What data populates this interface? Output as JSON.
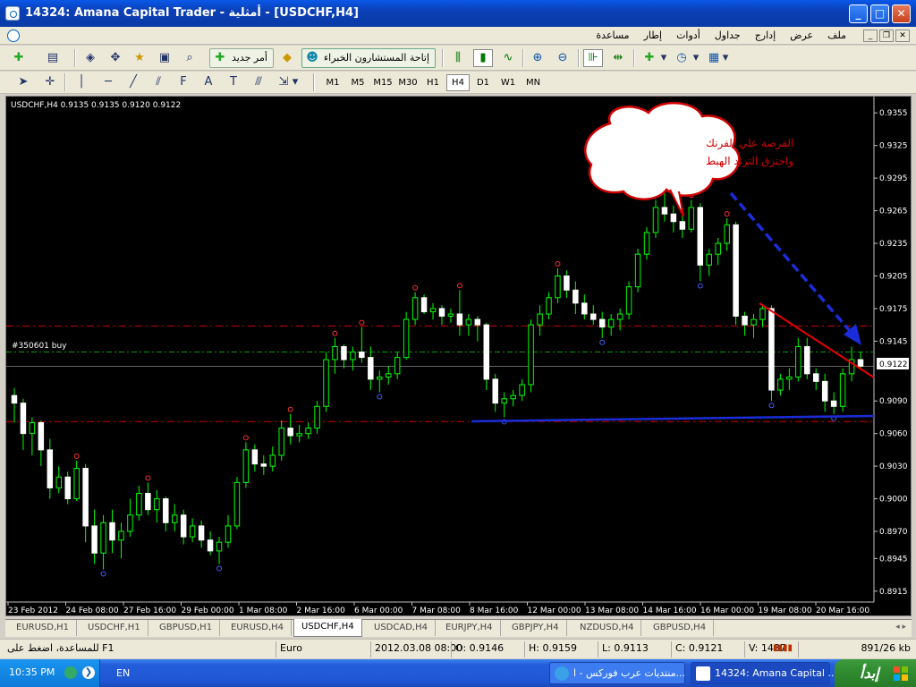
{
  "window": {
    "title": "14324: Amana Capital Trader - أمثلية - [USDCHF,H4]",
    "min": "_",
    "max": "□",
    "close": "✕"
  },
  "menu": [
    "ملف",
    "عرض",
    "إدارج",
    "جداول",
    "أدوات",
    "إطار",
    "مساعدة"
  ],
  "toolbar1": {
    "new_order": "أمر جديد",
    "experts": "إتاحة المستشارون الخبراء"
  },
  "timeframes": [
    "M1",
    "M5",
    "M15",
    "M30",
    "H1",
    "H4",
    "D1",
    "W1",
    "MN"
  ],
  "active_timeframe": "H4",
  "chart": {
    "header": "USDCHF,H4  0.9135 0.9135 0.9120 0.9122",
    "order_label": "#350601 buy",
    "current_price": "0.9122",
    "price_labels": [
      "0.9355",
      "0.9325",
      "0.9295",
      "0.9265",
      "0.9235",
      "0.9205",
      "0.9175",
      "0.9145",
      "0.9122",
      "0.9090",
      "0.9060",
      "0.9030",
      "0.9000",
      "0.8970",
      "0.8945",
      "0.8915"
    ],
    "time_labels": [
      "23 Feb 2012",
      "24 Feb 08:00",
      "27 Feb 16:00",
      "29 Feb 00:00",
      "1 Mar 08:00",
      "2 Mar 16:00",
      "6 Mar 00:00",
      "7 Mar 08:00",
      "8 Mar 16:00",
      "12 Mar 00:00",
      "13 Mar 08:00",
      "14 Mar 16:00",
      "16 Mar 00:00",
      "19 Mar 08:00",
      "20 Mar 16:00"
    ],
    "bubble_line1": "الفرصة علي الفرنك",
    "bubble_line2": "واختزق الترند الهبط",
    "bull_color": "#00ff00",
    "background": "#000000"
  },
  "chart_data": {
    "type": "candlestick",
    "symbol": "USDCHF",
    "timeframe": "H4",
    "ylim": [
      0.8905,
      0.937
    ],
    "price_levels": {
      "resistance_red_dash": 0.9159,
      "order_green": 0.9135,
      "current": 0.9122,
      "support_red_dash": 0.9071
    },
    "series": [
      {
        "values": [
          [
            0.9095,
            0.9102,
            0.907,
            0.9088
          ],
          [
            0.9088,
            0.9092,
            0.9045,
            0.906
          ],
          [
            0.906,
            0.9075,
            0.904,
            0.907
          ],
          [
            0.907,
            0.9072,
            0.903,
            0.9045
          ],
          [
            0.9045,
            0.9055,
            0.9,
            0.901
          ],
          [
            0.901,
            0.903,
            0.9005,
            0.902
          ],
          [
            0.902,
            0.9025,
            0.8995,
            0.9
          ],
          [
            0.9,
            0.9035,
            0.8998,
            0.9028
          ],
          [
            0.9028,
            0.9032,
            0.896,
            0.8975
          ],
          [
            0.8975,
            0.899,
            0.894,
            0.895
          ],
          [
            0.895,
            0.8985,
            0.8935,
            0.8978
          ],
          [
            0.8978,
            0.899,
            0.895,
            0.8962
          ],
          [
            0.8962,
            0.8978,
            0.8945,
            0.897
          ],
          [
            0.897,
            0.9,
            0.8965,
            0.8985
          ],
          [
            0.8985,
            0.9012,
            0.898,
            0.9005
          ],
          [
            0.9005,
            0.9015,
            0.8985,
            0.899
          ],
          [
            0.899,
            0.9008,
            0.8978,
            0.9
          ],
          [
            0.9,
            0.9002,
            0.897,
            0.8978
          ],
          [
            0.8978,
            0.8995,
            0.897,
            0.8985
          ],
          [
            0.8985,
            0.899,
            0.8958,
            0.8965
          ],
          [
            0.8965,
            0.8982,
            0.896,
            0.8975
          ],
          [
            0.8975,
            0.898,
            0.8955,
            0.8962
          ],
          [
            0.8962,
            0.897,
            0.8948,
            0.8952
          ],
          [
            0.8952,
            0.8965,
            0.894,
            0.896
          ],
          [
            0.896,
            0.8985,
            0.8955,
            0.8975
          ],
          [
            0.8975,
            0.902,
            0.8972,
            0.9015
          ],
          [
            0.9015,
            0.9052,
            0.901,
            0.9045
          ],
          [
            0.9045,
            0.905,
            0.9025,
            0.9032
          ],
          [
            0.9032,
            0.904,
            0.9022,
            0.903
          ],
          [
            0.903,
            0.9048,
            0.9025,
            0.904
          ],
          [
            0.904,
            0.9072,
            0.9035,
            0.9065
          ],
          [
            0.9065,
            0.9078,
            0.905,
            0.9058
          ],
          [
            0.9058,
            0.9068,
            0.9052,
            0.906
          ],
          [
            0.906,
            0.907,
            0.9055,
            0.9065
          ],
          [
            0.9065,
            0.909,
            0.906,
            0.9085
          ],
          [
            0.9085,
            0.9135,
            0.908,
            0.9128
          ],
          [
            0.9128,
            0.9148,
            0.9115,
            0.914
          ],
          [
            0.914,
            0.9142,
            0.912,
            0.9128
          ],
          [
            0.9128,
            0.914,
            0.9118,
            0.9135
          ],
          [
            0.9135,
            0.9158,
            0.9125,
            0.913
          ],
          [
            0.913,
            0.914,
            0.91,
            0.911
          ],
          [
            0.911,
            0.9118,
            0.9098,
            0.9112
          ],
          [
            0.9112,
            0.9122,
            0.9105,
            0.9115
          ],
          [
            0.9115,
            0.9135,
            0.911,
            0.913
          ],
          [
            0.913,
            0.9172,
            0.9128,
            0.9165
          ],
          [
            0.9165,
            0.919,
            0.916,
            0.9185
          ],
          [
            0.9185,
            0.9188,
            0.917,
            0.9172
          ],
          [
            0.9172,
            0.918,
            0.9165,
            0.9175
          ],
          [
            0.9175,
            0.9178,
            0.916,
            0.9168
          ],
          [
            0.9168,
            0.9175,
            0.9162,
            0.917
          ],
          [
            0.917,
            0.9192,
            0.915,
            0.916
          ],
          [
            0.916,
            0.917,
            0.915,
            0.9165
          ],
          [
            0.9165,
            0.9168,
            0.9145,
            0.916
          ],
          [
            0.916,
            0.9162,
            0.91,
            0.911
          ],
          [
            0.911,
            0.9115,
            0.908,
            0.9088
          ],
          [
            0.9088,
            0.9098,
            0.9075,
            0.9092
          ],
          [
            0.9092,
            0.91,
            0.9085,
            0.9095
          ],
          [
            0.9095,
            0.911,
            0.909,
            0.9105
          ],
          [
            0.9105,
            0.9165,
            0.9098,
            0.916
          ],
          [
            0.916,
            0.9178,
            0.915,
            0.917
          ],
          [
            0.917,
            0.919,
            0.9165,
            0.9185
          ],
          [
            0.9185,
            0.9212,
            0.918,
            0.9205
          ],
          [
            0.9205,
            0.921,
            0.9185,
            0.9192
          ],
          [
            0.9192,
            0.92,
            0.917,
            0.918
          ],
          [
            0.918,
            0.9188,
            0.9165,
            0.917
          ],
          [
            0.917,
            0.9178,
            0.916,
            0.9165
          ],
          [
            0.9165,
            0.9172,
            0.9148,
            0.9158
          ],
          [
            0.9158,
            0.917,
            0.915,
            0.9165
          ],
          [
            0.9165,
            0.9175,
            0.9155,
            0.917
          ],
          [
            0.917,
            0.92,
            0.9165,
            0.9195
          ],
          [
            0.9195,
            0.923,
            0.919,
            0.9225
          ],
          [
            0.9225,
            0.925,
            0.922,
            0.9245
          ],
          [
            0.9245,
            0.9275,
            0.924,
            0.9268
          ],
          [
            0.9268,
            0.9285,
            0.9255,
            0.9262
          ],
          [
            0.9262,
            0.927,
            0.9245,
            0.9255
          ],
          [
            0.9255,
            0.9262,
            0.924,
            0.9248
          ],
          [
            0.9248,
            0.9275,
            0.9245,
            0.9268
          ],
          [
            0.9268,
            0.9272,
            0.92,
            0.9215
          ],
          [
            0.9215,
            0.923,
            0.9205,
            0.9225
          ],
          [
            0.9225,
            0.924,
            0.9215,
            0.9235
          ],
          [
            0.9235,
            0.9258,
            0.9228,
            0.9252
          ],
          [
            0.9252,
            0.9255,
            0.916,
            0.9168
          ],
          [
            0.9168,
            0.9172,
            0.915,
            0.916
          ],
          [
            0.916,
            0.917,
            0.9148,
            0.9165
          ],
          [
            0.9165,
            0.9178,
            0.9158,
            0.9175
          ],
          [
            0.9175,
            0.9178,
            0.909,
            0.91
          ],
          [
            0.91,
            0.9115,
            0.9095,
            0.911
          ],
          [
            0.911,
            0.912,
            0.91,
            0.9112
          ],
          [
            0.9112,
            0.9148,
            0.9108,
            0.914
          ],
          [
            0.914,
            0.9148,
            0.911,
            0.9115
          ],
          [
            0.9115,
            0.912,
            0.91,
            0.9108
          ],
          [
            0.9108,
            0.9115,
            0.908,
            0.909
          ],
          [
            0.909,
            0.9098,
            0.9078,
            0.9085
          ],
          [
            0.9085,
            0.912,
            0.908,
            0.9115
          ],
          [
            0.9115,
            0.914,
            0.9108,
            0.9128
          ],
          [
            0.9128,
            0.9135,
            0.912,
            0.9122
          ]
        ]
      }
    ]
  },
  "tabs": [
    "EURUSD,H1",
    "USDCHF,H1",
    "GBPUSD,H1",
    "EURUSD,H4",
    "USDCHF,H4",
    "USDCAD,H4",
    "EURJPY,H4",
    "GBPJPY,H4",
    "NZDUSD,H4",
    "GBPUSD,H4"
  ],
  "active_tab": "USDCHF,H4",
  "status": {
    "help": "للمساعدة، اضغط على F1",
    "profile": "Euro",
    "datetime": "2012.03.08 08:00",
    "open": "O: 0.9146",
    "high": "H: 0.9159",
    "low": "L: 0.9113",
    "close": "C: 0.9121",
    "volume": "V: 1437",
    "traffic": "891/26 kb"
  },
  "taskbar": {
    "clock": "10:35 PM",
    "lang": "EN",
    "task1": "14324: Amana Capital ...",
    "task2": "منتديات عرب فوركس - ا...",
    "start": "إبدأ"
  }
}
